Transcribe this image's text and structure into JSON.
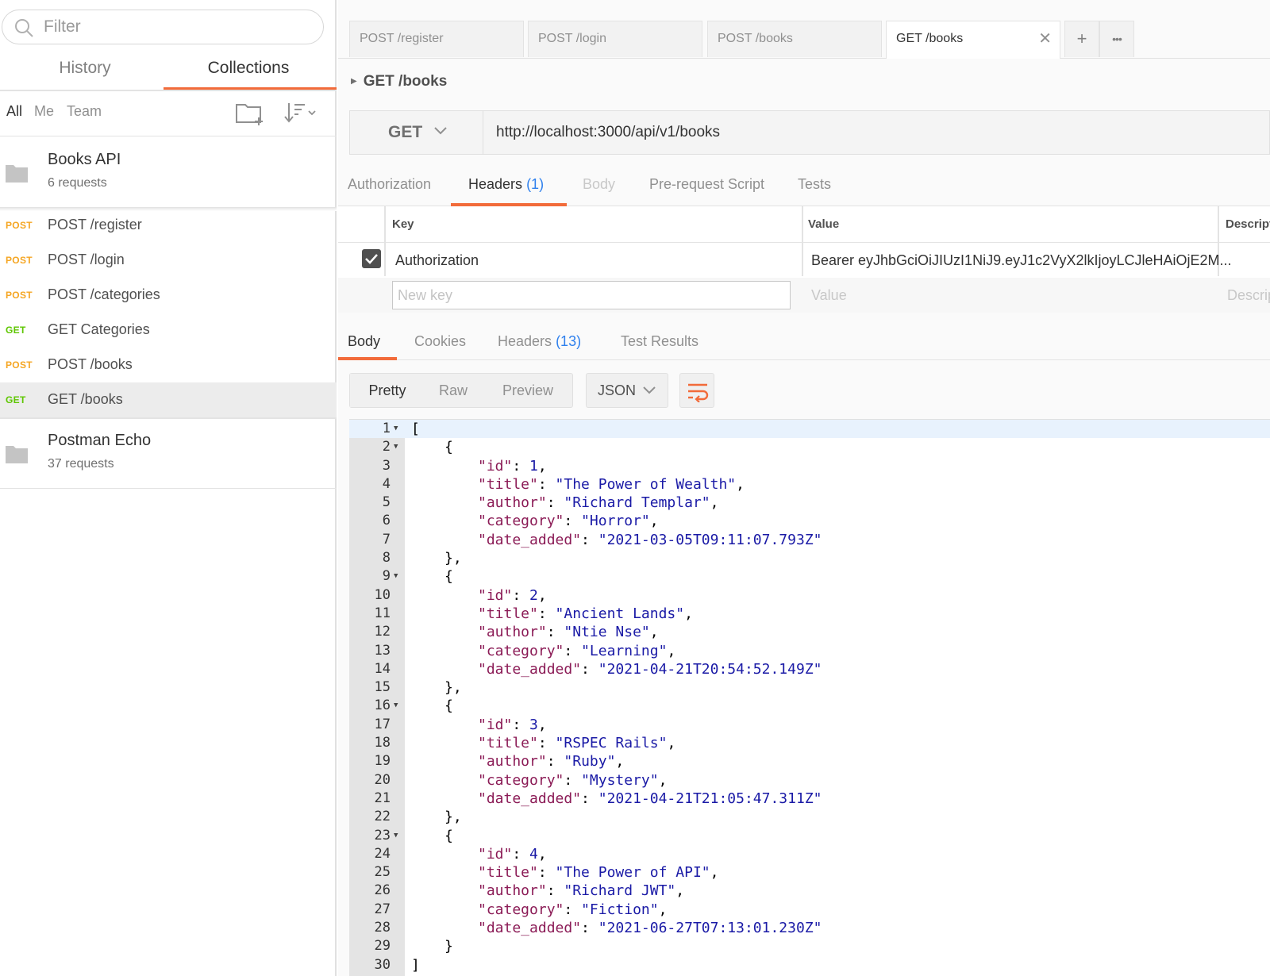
{
  "sidebar": {
    "filter_placeholder": "Filter",
    "tabs": [
      {
        "label": "History"
      },
      {
        "label": "Collections"
      }
    ],
    "owners": [
      {
        "label": "All"
      },
      {
        "label": "Me"
      },
      {
        "label": "Team"
      }
    ],
    "collections": [
      {
        "name": "Books API",
        "count": "6 requests"
      },
      {
        "name": "Postman Echo",
        "count": "37 requests"
      }
    ],
    "requests": [
      {
        "method": "POST",
        "name": "POST /register"
      },
      {
        "method": "POST",
        "name": "POST /login"
      },
      {
        "method": "POST",
        "name": "POST /categories"
      },
      {
        "method": "GET",
        "name": "GET Categories"
      },
      {
        "method": "POST",
        "name": "POST /books"
      },
      {
        "method": "GET",
        "name": "GET /books"
      }
    ]
  },
  "tabs": [
    {
      "label": "POST /register"
    },
    {
      "label": "POST /login"
    },
    {
      "label": "POST /books"
    },
    {
      "label": "GET /books"
    }
  ],
  "tab_buttons": {
    "add": "+",
    "more": "•••",
    "close": "✕"
  },
  "request": {
    "name": "GET /books",
    "method": "GET",
    "url": "http://localhost:3000/api/v1/books"
  },
  "request_tabs": {
    "authorization": "Authorization",
    "headers": "Headers",
    "headers_count": "(1)",
    "body": "Body",
    "prerequest": "Pre-request Script",
    "tests": "Tests"
  },
  "headers_table": {
    "col_key": "Key",
    "col_value": "Value",
    "col_desc": "Descript",
    "row_key": "Authorization",
    "row_value": "Bearer eyJhbGciOiJIUzI1NiJ9.eyJ1c2VyX2lkIjoyLCJleHAiOjE2M...",
    "new_key_placeholder": "New key",
    "value_placeholder": "Value",
    "desc_placeholder": "Descrip"
  },
  "response_tabs": {
    "body": "Body",
    "cookies": "Cookies",
    "headers": "Headers",
    "headers_count": "(13)",
    "tests": "Test Results"
  },
  "view": {
    "pretty": "Pretty",
    "raw": "Raw",
    "preview": "Preview",
    "format": "JSON"
  },
  "books": [
    {
      "id": 1,
      "title": "The Power of Wealth",
      "author": "Richard Templar",
      "category": "Horror",
      "date_added": "2021-03-05T09:11:07.793Z"
    },
    {
      "id": 2,
      "title": "Ancient Lands",
      "author": "Ntie Nse",
      "category": "Learning",
      "date_added": "2021-04-21T20:54:52.149Z"
    },
    {
      "id": 3,
      "title": "RSPEC Rails",
      "author": "Ruby",
      "category": "Mystery",
      "date_added": "2021-04-21T21:05:47.311Z"
    },
    {
      "id": 4,
      "title": "The Power of API",
      "author": "Richard JWT",
      "category": "Fiction",
      "date_added": "2021-06-27T07:13:01.230Z"
    }
  ]
}
